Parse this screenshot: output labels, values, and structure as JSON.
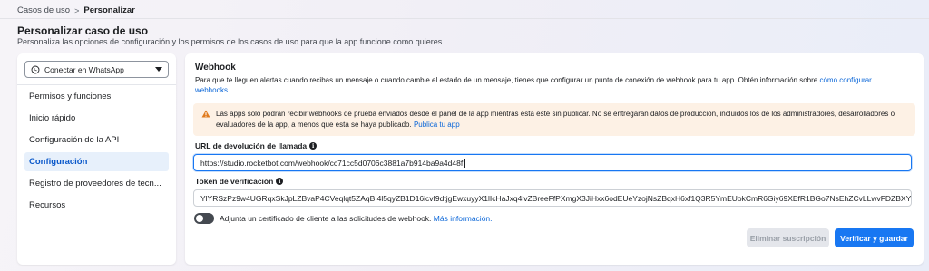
{
  "breadcrumb": {
    "parent": "Casos de uso",
    "separator": ">",
    "current": "Personalizar"
  },
  "page": {
    "title": "Personalizar caso de uso",
    "subtitle": "Personaliza las opciones de configuración y los permisos de los casos de uso para que la app funcione como quieres."
  },
  "sidebar": {
    "usecase_select": {
      "value": "Conectar en WhatsApp",
      "icon": "whatsapp-icon"
    },
    "items": [
      {
        "label": "Permisos y funciones",
        "active": false
      },
      {
        "label": "Inicio rápido",
        "active": false
      },
      {
        "label": "Configuración de la API",
        "active": false
      },
      {
        "label": "Configuración",
        "active": true
      },
      {
        "label": "Registro de proveedores de tecn...",
        "active": false
      },
      {
        "label": "Recursos",
        "active": false
      }
    ]
  },
  "webhook": {
    "title": "Webhook",
    "description": "Para que te lleguen alertas cuando recibas un mensaje o cuando cambie el estado de un mensaje, tienes que configurar un punto de conexión de webhook para tu app. Obtén información sobre ",
    "description_link": "cómo configurar webhooks",
    "description_end": ".",
    "warning_text": "Las apps solo podrán recibir webhooks de prueba enviados desde el panel de la app mientras esta esté sin publicar. No se entregarán datos de producción, incluidos los de los administradores, desarrolladores o evaluadores de la app, a menos que esta se haya publicado. ",
    "warning_link": "Publica tu app",
    "callback_label": "URL de devolución de llamada",
    "callback_value": "https://studio.rocketbot.com/webhook/cc71cc5d0706c3881a7b914ba9a4d48f",
    "token_label": "Token de verificación",
    "token_value": "YlYRSzPz9w4UGRqxSkJpLZBvaP4CVeqlqt5ZAqBI4l5qyZB1D16icvI9dtjgEwxuyyX1lIcHaJxq4lvZBreeFfPXmgX3JiHxx6odEUeYzojNsZBqxH6xf1Q3R5YmEUokCmR6Giy69XEfR1BGo7NsEhZCvLLwvFDZBXY0tOKsfl1vl0ZD",
    "cert_label": "Adjunta un certificado de cliente a las solicitudes de webhook. ",
    "cert_link": "Más información.",
    "cert_enabled": false,
    "delete_button": "Eliminar suscripción",
    "save_button": "Verificar y guardar"
  },
  "colors": {
    "accent": "#1877f2",
    "active_nav_bg": "#e7f0fb",
    "warning_bg": "#fdf1e5",
    "warning_icon": "#e07b1f"
  }
}
